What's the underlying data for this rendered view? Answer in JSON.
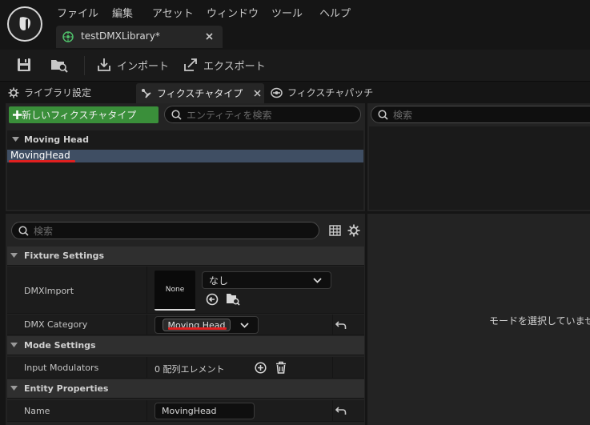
{
  "menu": [
    "ファイル",
    "編集",
    "アセット",
    "ウィンドウ",
    "ツール",
    "ヘルプ"
  ],
  "document_tab": {
    "title": "testDMXLibrary*"
  },
  "toolbar": {
    "import_label": "インポート",
    "export_label": "エクスポート"
  },
  "panel_tabs": {
    "library_settings": "ライブラリ設定",
    "fixture_types": "フィクスチャタイプ",
    "fixture_patches": "フィクスチャパッチ"
  },
  "fixture_types": {
    "new_button": "新しいフィクスチャタイプ",
    "search_placeholder": "エンティティを検索",
    "category": "Moving Head",
    "items": [
      "MovingHead"
    ]
  },
  "right_panel": {
    "search_placeholder": "検索",
    "empty_message": "モードを選択していませ"
  },
  "details": {
    "search_placeholder": "検索",
    "sections": {
      "fixture_settings": "Fixture Settings",
      "mode_settings": "Mode Settings",
      "entity_properties": "Entity Properties"
    },
    "dmx_import": {
      "label": "DMXImport",
      "thumbnail": "None",
      "value": "なし"
    },
    "dmx_category": {
      "label": "DMX Category",
      "value": "Moving Head"
    },
    "input_modulators": {
      "label": "Input Modulators",
      "value": "0 配列エレメント"
    },
    "name": {
      "label": "Name",
      "value": "MovingHead"
    }
  },
  "colors": {
    "accent_green": "#3a8f3a",
    "underline_red": "#e02020",
    "selected_row": "#3f4e63"
  }
}
